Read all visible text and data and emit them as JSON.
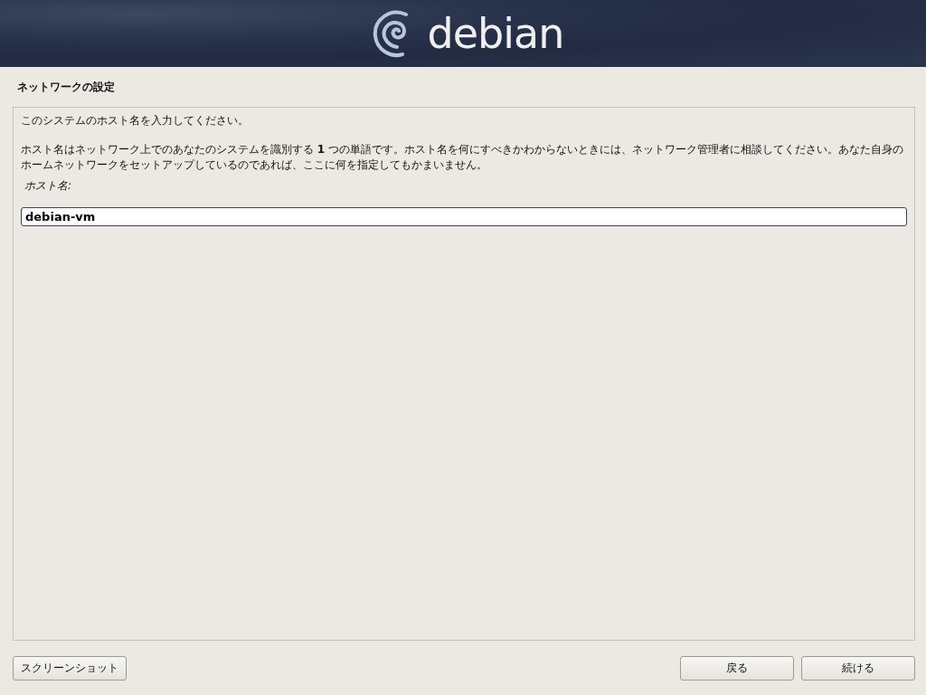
{
  "header": {
    "logo_text": "debian"
  },
  "title": "ネットワークの設定",
  "intro": "このシステムのホスト名を入力してください。",
  "description": "ホスト名はネットワーク上でのあなたのシステムを識別する **1** つの単語です。ホスト名を何にすべきかわからないときには、ネットワーク管理者に相談してください。あなた自身のホームネットワークをセットアップしているのであれば、ここに何を指定してもかまいません。",
  "field": {
    "label": "ホスト名:",
    "value": "debian-vm"
  },
  "buttons": [
    {
      "label": "スクリーンショット",
      "kind": "left"
    },
    {
      "label": "戻る",
      "kind": "right"
    },
    {
      "label": "続ける",
      "kind": "right"
    }
  ]
}
